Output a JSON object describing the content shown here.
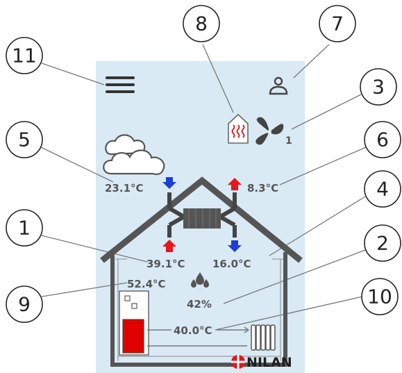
{
  "temperatures": {
    "outdoor": "23.1°C",
    "exhaust": "8.3°C",
    "supply": "39.1°C",
    "extract": "16.0°C",
    "hot_water": "52.4°C",
    "heating": "40.0°C"
  },
  "humidity": "42%",
  "fan_level": "1",
  "brand": "NILAN",
  "callouts": [
    "1",
    "2",
    "3",
    "4",
    "5",
    "6",
    "7",
    "8",
    "9",
    "10",
    "11"
  ],
  "colors": {
    "panel_bg": "#d9eaf5",
    "house_outline": "#555555",
    "arrow_warm": "#e8151b",
    "arrow_cold": "#1d3fd6",
    "heater_icon": "#d42a2a",
    "tank_fill": "#e00000"
  },
  "icons": {
    "menu": "hamburger-menu-icon",
    "user": "user-icon",
    "fan": "fan-icon",
    "heater": "heater-icon",
    "weather": "cloud-icon",
    "humidity": "droplets-icon",
    "radiator": "radiator-icon",
    "logo": "nilan-logo"
  }
}
